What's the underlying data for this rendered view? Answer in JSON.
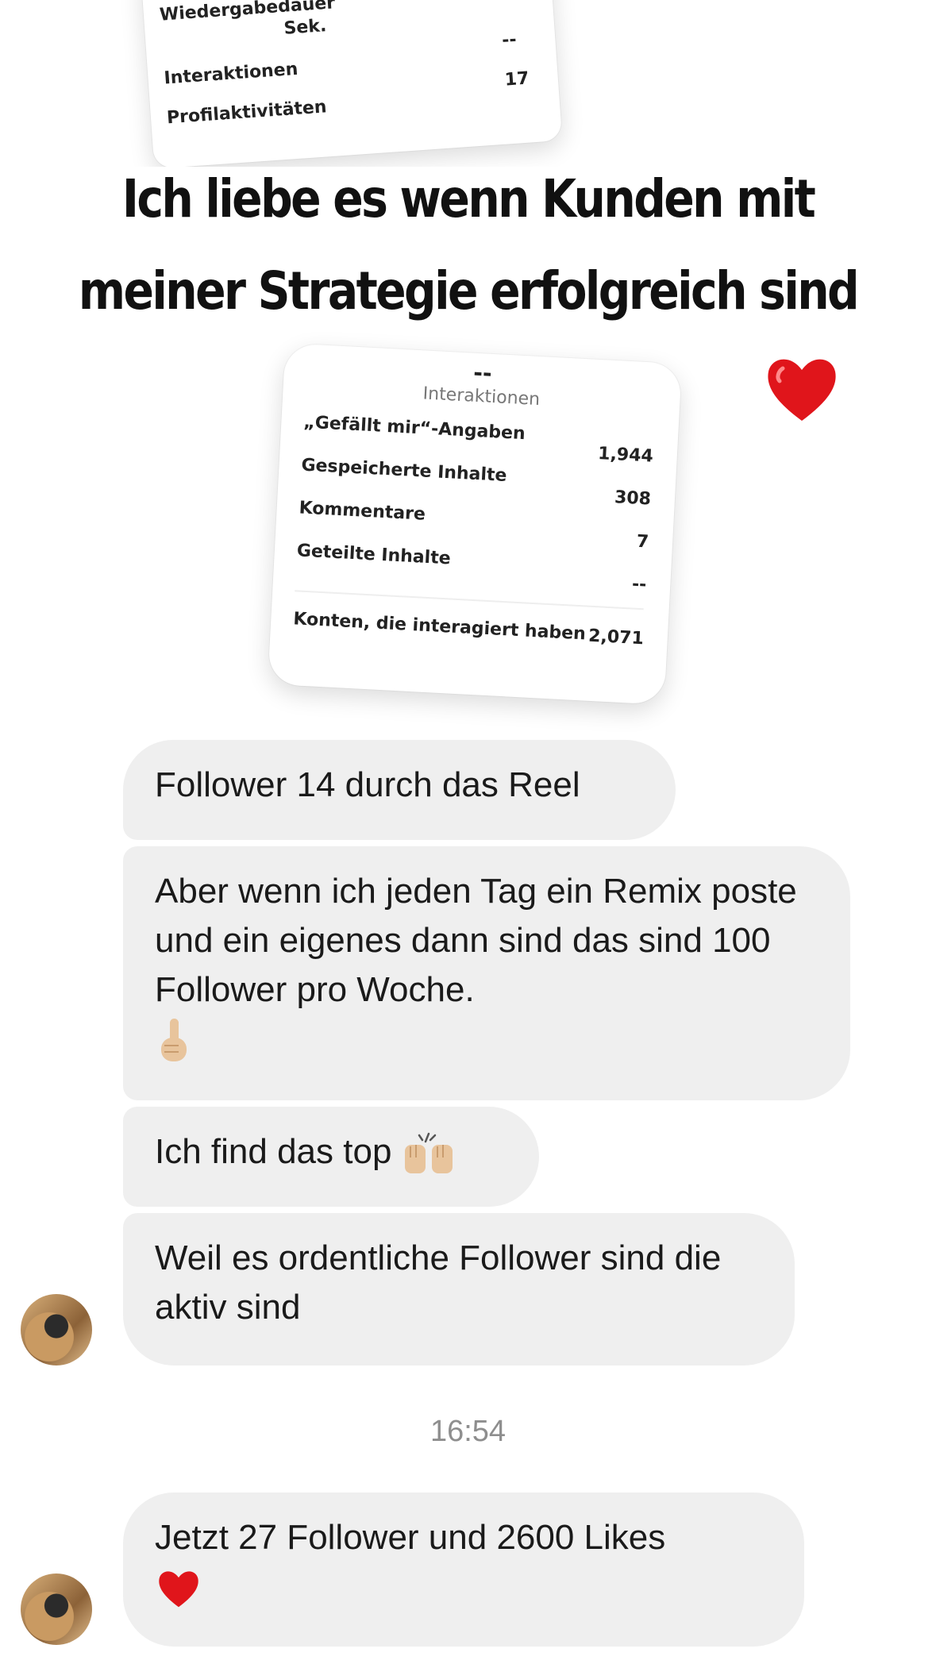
{
  "card_top": {
    "rows": [
      {
        "label": "Wiedergabedauer",
        "value": "Sek."
      },
      {
        "label": "Interaktionen",
        "value": "--"
      },
      {
        "label": "Profilaktivitäten",
        "value": "17"
      }
    ]
  },
  "headline": {
    "line1": "Ich liebe es wenn Kunden mit",
    "line2": "meiner Strategie erfolgreich sind"
  },
  "card_stats": {
    "top_dash": "--",
    "section_title": "Interaktionen",
    "rows": [
      {
        "label": "„Gefällt mir“-Angaben",
        "value": "1,944"
      },
      {
        "label": "Gespeicherte Inhalte",
        "value": "308"
      },
      {
        "label": "Kommentare",
        "value": "7"
      },
      {
        "label": "Geteilte Inhalte",
        "value": "--"
      }
    ],
    "summary": {
      "label": "Konten, die interagiert haben",
      "value": "2,071"
    }
  },
  "messages": [
    {
      "text": "Follower 14 durch das Reel"
    },
    {
      "text": "Aber wenn ich jeden Tag ein Remix poste und ein eigenes dann sind das sind 100 Follower pro Woche.",
      "emoji": "pointing-up-emoji"
    },
    {
      "text": "Ich find das top",
      "emoji": "raised-hands-emoji"
    },
    {
      "text": "Weil es ordentliche Follower sind die aktiv sind"
    }
  ],
  "timestamp": "16:54",
  "last_message": {
    "text": "Jetzt 27 Follower und 2600 Likes",
    "emoji": "red-heart-emoji"
  },
  "colors": {
    "bubble_bg": "#efefef",
    "heart": "#e0151b",
    "timestamp": "#8e8e8e"
  }
}
